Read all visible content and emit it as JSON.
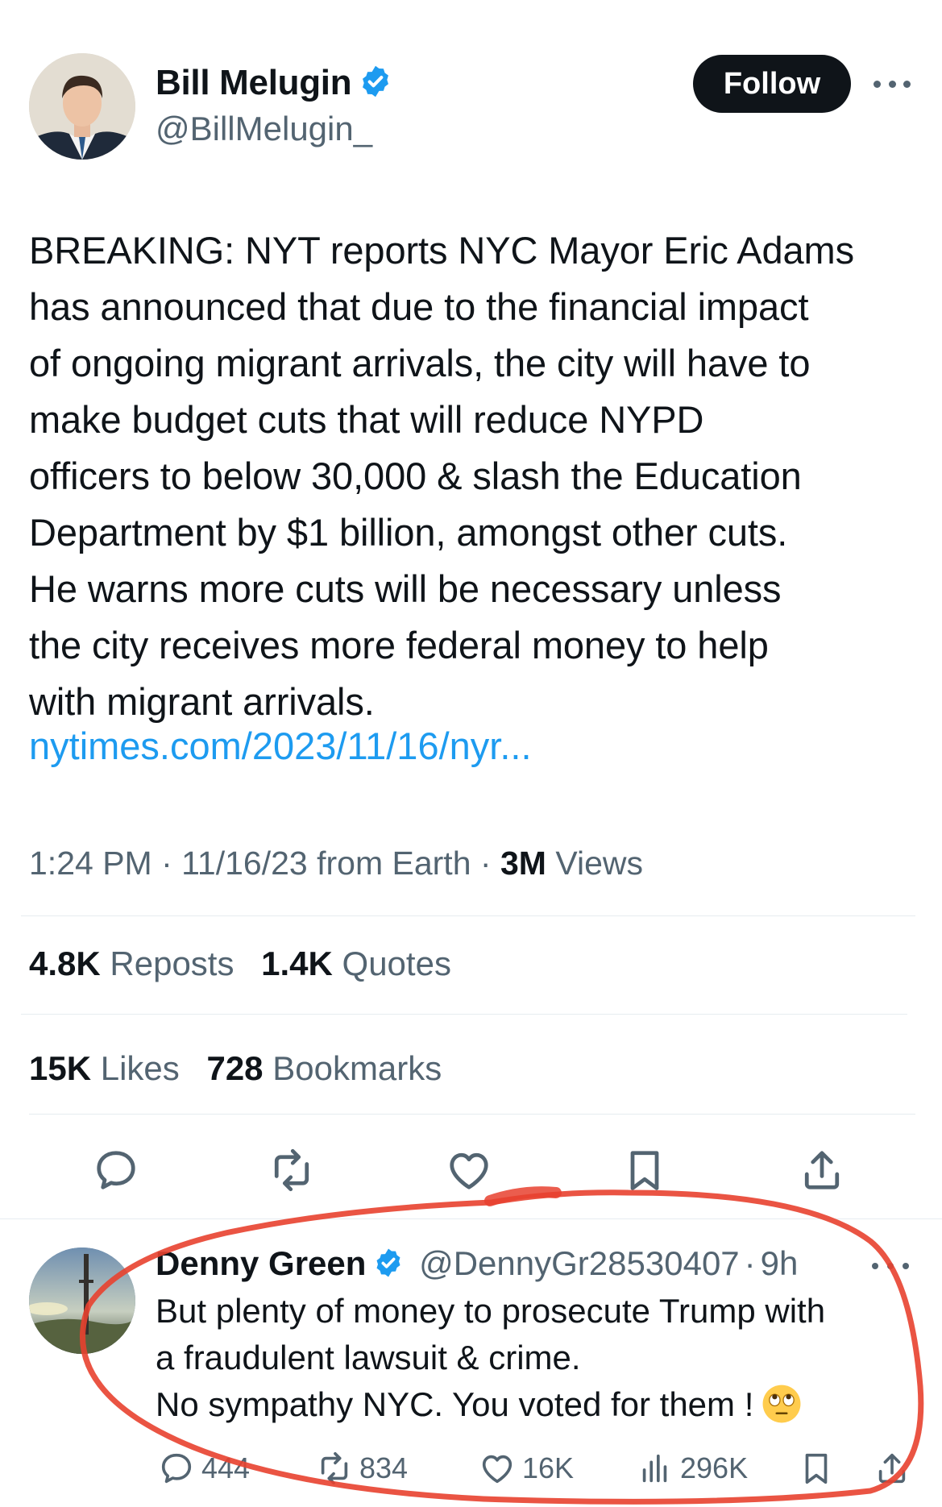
{
  "tweet": {
    "author_name": "Bill Melugin",
    "author_handle": "@BillMelugin_",
    "follow_label": "Follow",
    "text": "BREAKING: NYT reports NYC Mayor Eric Adams\nhas announced that due to the financial impact\nof ongoing migrant arrivals, the city will have to\nmake budget cuts that will reduce NYPD\nofficers to below 30,000 & slash the Education\nDepartment by $1 billion, amongst other cuts.\nHe warns more cuts will be necessary unless\nthe city receives more federal money to help\nwith migrant arrivals.",
    "link": "nytimes.com/2023/11/16/nyr...",
    "time": "1:24 PM",
    "date": "11/16/23 from Earth",
    "views_count": "3M",
    "views_label": "Views",
    "reposts_count": "4.8K",
    "reposts_label": "Reposts",
    "quotes_count": "1.4K",
    "quotes_label": "Quotes",
    "likes_count": "15K",
    "likes_label": "Likes",
    "bookmarks_count": "728",
    "bookmarks_label": "Bookmarks",
    "actions": [
      "reply-icon",
      "repost-icon",
      "like-icon",
      "bookmark-icon",
      "share-icon"
    ]
  },
  "reply": {
    "author_name": "Denny Green",
    "author_handle": "@DennyGr28530407",
    "separator": "·",
    "time": "9h",
    "text": "But plenty of money to prosecute Trump with\na fraudulent lawsuit & crime.\nNo sympathy NYC. You voted for them !",
    "emoji": "face-with-rolling-eyes",
    "reply_count": "444",
    "repost_count": "834",
    "like_count": "16K",
    "view_count": "296K"
  },
  "colors": {
    "text": "#0f1419",
    "secondary": "#536471",
    "link": "#1d9bf0",
    "verified": "#1d9bf0",
    "annotation": "#e8412f"
  }
}
